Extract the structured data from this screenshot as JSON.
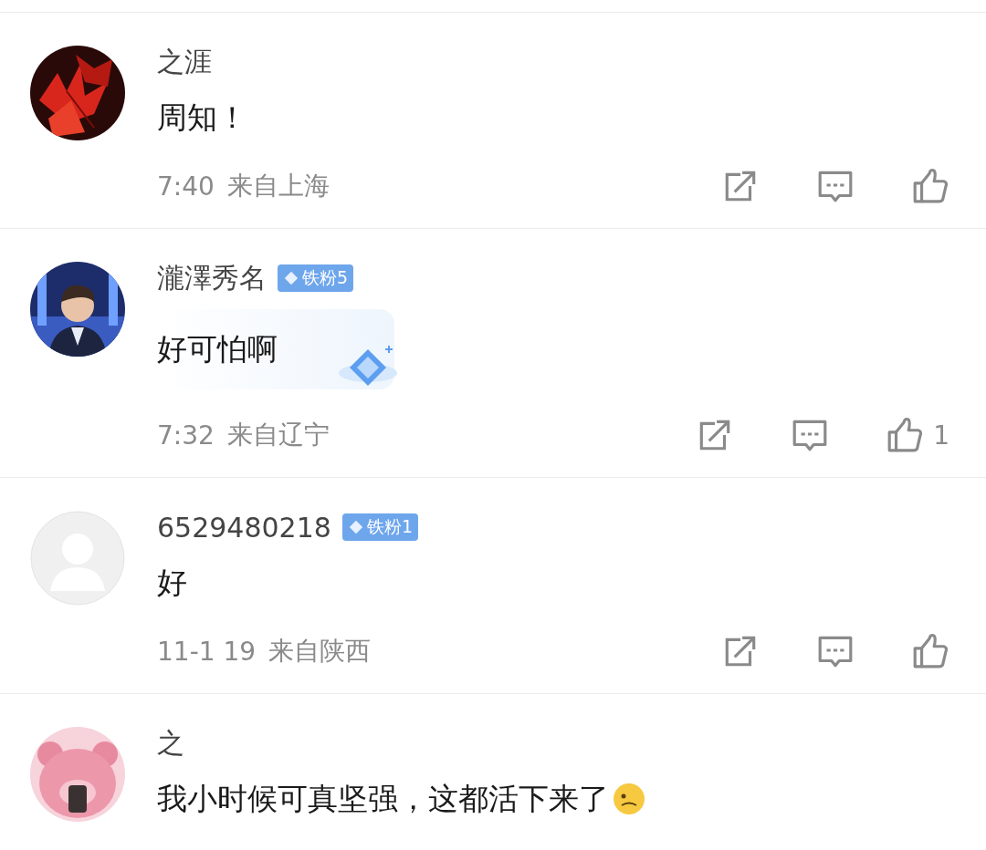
{
  "comments": [
    {
      "name": "之涯",
      "text": "周知！",
      "bubble": false,
      "time": "7:40",
      "location": "来自上海"
    },
    {
      "name": "瀧澤秀名",
      "badge": "铁粉5",
      "text": "好可怕啊",
      "bubble": true,
      "time": "7:32",
      "location": "来自辽宁",
      "likes": "1"
    },
    {
      "avatar": {
        "kind": "default"
      },
      "name": "6529480218",
      "badge": "铁粉1",
      "text": "好",
      "bubble": false,
      "time": "11-1 19",
      "location": "来自陕西"
    },
    {
      "name": "之",
      "text": "我小时候可真坚强，这都活下来了",
      "emoji": true,
      "bubble": false
    }
  ]
}
